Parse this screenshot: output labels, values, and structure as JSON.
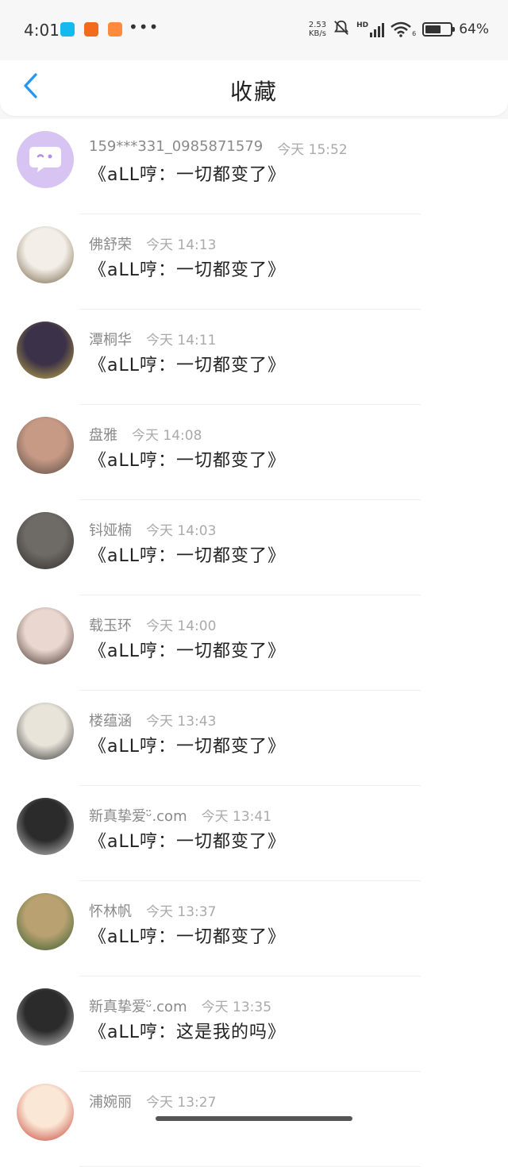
{
  "status_bar": {
    "time": "4:01",
    "more": "•••",
    "net_speed_value": "2.53",
    "net_speed_unit": "KB/s",
    "battery_percent": "64",
    "battery_label": "64%",
    "battery_level": 0.64,
    "hd_label": "HD",
    "signal_label": "6"
  },
  "header": {
    "back_icon": "chevron-left-icon",
    "title": "收藏",
    "accent_color": "#2196f3"
  },
  "favorites": [
    {
      "name": "159***331_0985871579",
      "time": "今天 15:52",
      "message": "《aLL哼：一切都变了》",
      "avatar": "chat-bubble-icon"
    },
    {
      "name": "佛舒荣",
      "time": "今天 14:13",
      "message": "《aLL哼：一切都变了》",
      "avatar": "cartoon-avatar"
    },
    {
      "name": "潭桐华",
      "time": "今天 14:11",
      "message": "《aLL哼：一切都变了》",
      "avatar": "anime-avatar"
    },
    {
      "name": "盘雅",
      "time": "今天 14:08",
      "message": "《aLL哼：一切都变了》",
      "avatar": "photo-avatar"
    },
    {
      "name": "钭娅楠",
      "time": "今天 14:03",
      "message": "《aLL哼：一切都变了》",
      "avatar": "photo-avatar"
    },
    {
      "name": "载玉环",
      "time": "今天 14:00",
      "message": "《aLL哼：一切都变了》",
      "avatar": "photo-avatar"
    },
    {
      "name": "楼蕴涵",
      "time": "今天 13:43",
      "message": "《aLL哼：一切都变了》",
      "avatar": "photo-avatar"
    },
    {
      "name": "新真挚爱ᵕ̈.com",
      "time": "今天 13:41",
      "message": "《aLL哼：一切都变了》",
      "avatar": "photo-avatar"
    },
    {
      "name": "怀林帆",
      "time": "今天 13:37",
      "message": "《aLL哼：一切都变了》",
      "avatar": "photo-avatar"
    },
    {
      "name": "新真挚爱ᵕ̈.com",
      "time": "今天 13:35",
      "message": "《aLL哼：这是我的吗》",
      "avatar": "photo-avatar"
    },
    {
      "name": "浦婉丽",
      "time": "今天 13:27",
      "message": "",
      "avatar": "cartoon-avatar"
    }
  ]
}
